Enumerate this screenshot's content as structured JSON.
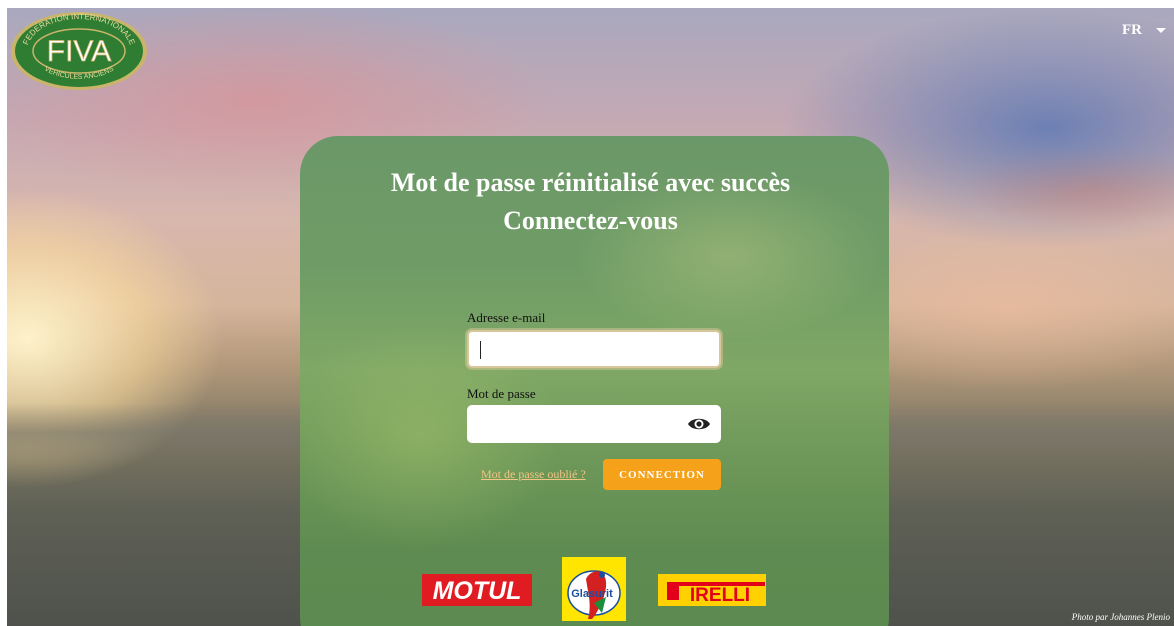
{
  "header": {
    "logo": {
      "initials": "FIVA",
      "ring_top": "FEDERATION INTERNATIONALE",
      "ring_bottom": "VEHICULES ANCIENS"
    },
    "language": {
      "selected": "FR"
    }
  },
  "card": {
    "title_line1": "Mot de passe réinitialisé avec succès",
    "title_line2": "Connectez-vous",
    "email": {
      "label": "Adresse e-mail",
      "value": "",
      "placeholder": ""
    },
    "password": {
      "label": "Mot de passe",
      "value": "",
      "placeholder": ""
    },
    "forgot_link": "Mot de passe oublié ?",
    "submit_label": "CONNECTION",
    "sponsors": {
      "motul": "MOTUL",
      "glasurit": "Glasurit",
      "pirelli": "IRELLI"
    }
  },
  "footer": {
    "photo_credit": "Photo par Johannes Plenio"
  },
  "colors": {
    "accent": "#f5a21a",
    "card_green": "#6f9c66",
    "link": "#f3c583",
    "logo_green": "#2e7d32"
  }
}
